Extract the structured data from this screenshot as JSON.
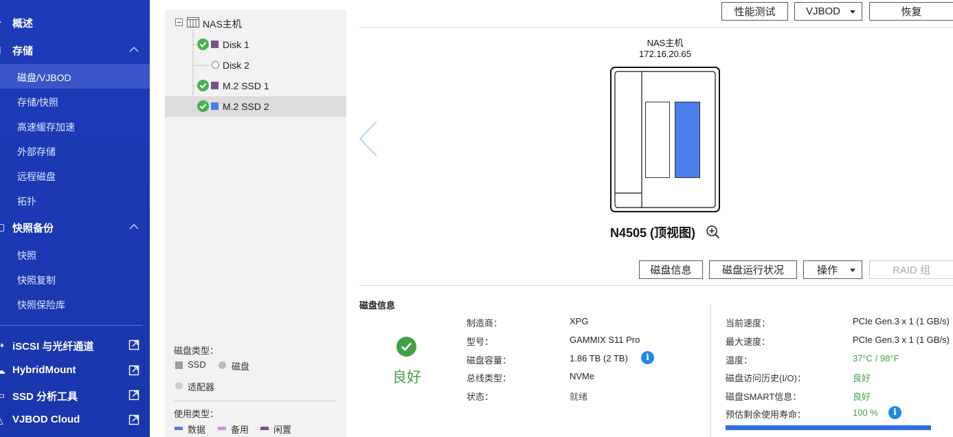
{
  "sidebar": {
    "overview": "概述",
    "storage": "存储",
    "storage_items": [
      "磁盘/VJBOD",
      "存储/快照",
      "高速缓存加速",
      "外部存储",
      "远程磁盘",
      "拓扑"
    ],
    "snapshot_backup": "快照备份",
    "snapshot_items": [
      "快照",
      "快照复制",
      "快照保险库"
    ],
    "links": [
      "iSCSI 与光纤通道",
      "HybridMount",
      "SSD 分析工具",
      "VJBOD Cloud"
    ]
  },
  "tree": {
    "root": "NAS主机",
    "items": [
      {
        "label": "Disk 1",
        "status": "ok",
        "color": "#7a4f86"
      },
      {
        "label": "Disk 2",
        "status": "empty",
        "color": ""
      },
      {
        "label": "M.2 SSD 1",
        "status": "ok",
        "color": "#7a4f86"
      },
      {
        "label": "M.2 SSD 2",
        "status": "ok",
        "color": "#4a7fea"
      }
    ]
  },
  "legend": {
    "disk_type_title": "磁盘类型：",
    "ssd": "SSD",
    "hdd": "磁盘",
    "adapter": "适配器",
    "usage_type_title": "使用类型：",
    "data": "数据",
    "spare": "备用",
    "free": "闲置",
    "colors": {
      "data": "#4a7fea",
      "spare": "#d48cf0",
      "free": "#7a4f86",
      "ssd": "#9e9e9e",
      "hdd": "#bdbdbd"
    }
  },
  "toolbar": {
    "perf_test": "性能测试",
    "vjbod": "VJBOD",
    "restore": "恢复"
  },
  "device": {
    "name": "NAS主机",
    "ip": "172.16.20.65",
    "model": "N4505 (顶视图)"
  },
  "disk_actions": {
    "disk_info": "磁盘信息",
    "disk_health": "磁盘运行状况",
    "action": "操作",
    "raid_group": "RAID 组"
  },
  "info": {
    "title": "磁盘信息",
    "status": "良好",
    "left": [
      {
        "key": "制造商：",
        "value": "XPG"
      },
      {
        "key": "型号：",
        "value": "GAMMIX S11 Pro"
      },
      {
        "key": "磁盘容量：",
        "value": "1.86 TB (2 TB)"
      },
      {
        "key": "总线类型：",
        "value": "NVMe"
      },
      {
        "key": "状态：",
        "value": "就绪"
      }
    ],
    "right": [
      {
        "key": "当前速度：",
        "value": "PCIe Gen.3 x 1 (1 GB/s)"
      },
      {
        "key": "最大速度：",
        "value": "PCIe Gen.3 x 1 (1 GB/s)"
      },
      {
        "key": "温度：",
        "value": "37°C / 98°F"
      },
      {
        "key": "磁盘访问历史(I/O)：",
        "value": "良好"
      },
      {
        "key": "磁盘SMART信息：",
        "value": "良好"
      },
      {
        "key": "预估剩余使用寿命：",
        "value": "100 %"
      }
    ],
    "life_percent": 100
  }
}
